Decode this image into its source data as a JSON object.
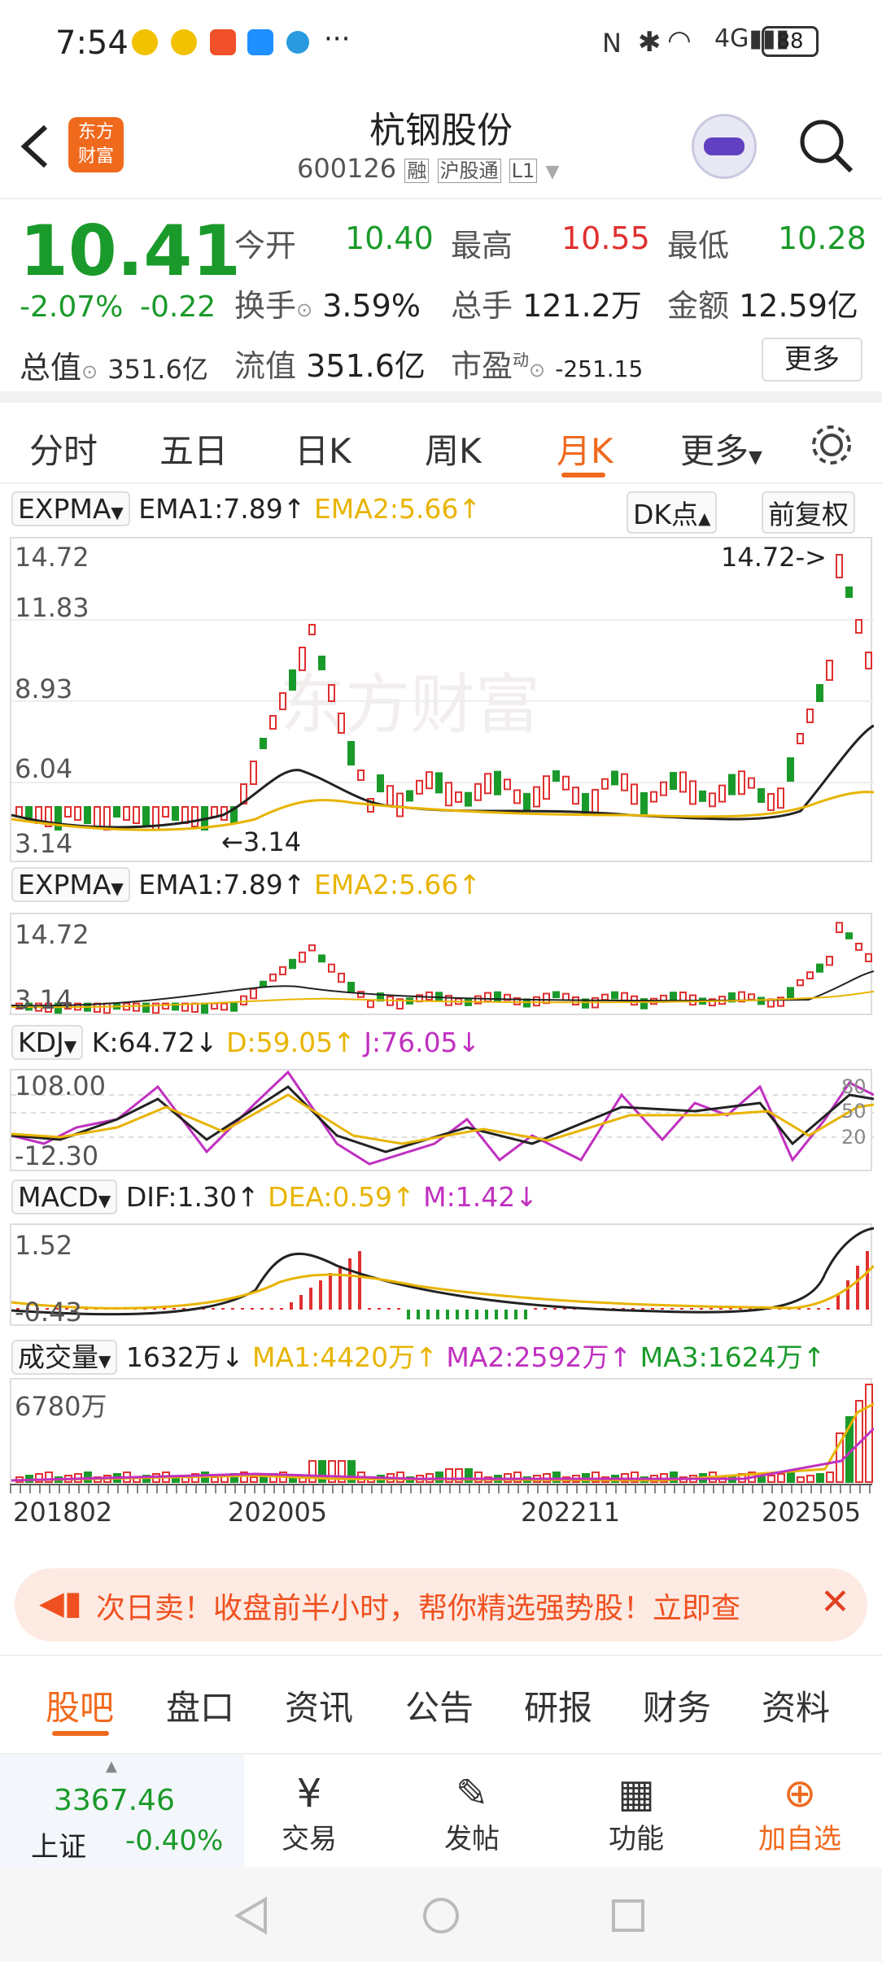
{
  "status": {
    "time": "7:54",
    "dots": "···",
    "battery": "88"
  },
  "header": {
    "title": "杭钢股份",
    "code": "600126",
    "tag1": "融",
    "tag2": "沪股通",
    "tag3": "L1",
    "logo_line1": "东方",
    "logo_line2": "财富"
  },
  "quote": {
    "price": "10.41",
    "change_pct": "-2.07%",
    "change": "-0.22",
    "open_label": "今开",
    "open": "10.40",
    "high_label": "最高",
    "high": "10.55",
    "low_label": "最低",
    "low": "10.28",
    "turnover_label": "换手",
    "turnover": "3.59%",
    "volume_label": "总手",
    "volume": "121.2万",
    "amount_label": "金额",
    "amount": "12.59亿",
    "mcap_label": "总值",
    "mcap": "351.6亿",
    "float_label": "流值",
    "float": "351.6亿",
    "pe_label": "市盈",
    "pe_sup": "动",
    "pe": "-251.15",
    "more": "更多"
  },
  "tabs": [
    "分时",
    "五日",
    "日K",
    "周K",
    "月K",
    "更多"
  ],
  "active_tab": "月K",
  "main": {
    "ind": "EXPMA",
    "ema1": "EMA1:7.89↑",
    "ema2": "EMA2:5.66↑",
    "dk": "DK点",
    "fq": "前复权",
    "y_labels": [
      "14.72",
      "11.83",
      "8.93",
      "6.04",
      "3.14"
    ],
    "max_label": "14.72->",
    "min_label": "←3.14",
    "watermark": "东方财富"
  },
  "expma": {
    "ind": "EXPMA",
    "ema1": "EMA1:7.89↑",
    "ema2": "EMA2:5.66↑",
    "y_top": "14.72",
    "y_bot": "3.14"
  },
  "kdj": {
    "ind": "KDJ",
    "k": "K:64.72↓",
    "d": "D:59.05↑",
    "j": "J:76.05↓",
    "y_top": "108.00",
    "y_bot": "-12.30",
    "r80": "80",
    "r50": "50",
    "r20": "20"
  },
  "macd": {
    "ind": "MACD",
    "dif": "DIF:1.30↑",
    "dea": "DEA:0.59↑",
    "m": "M:1.42↓",
    "y_top": "1.52",
    "y_bot": "-0.43"
  },
  "vol": {
    "ind": "成交量",
    "v": "1632万↓",
    "ma1": "MA1:4420万↑",
    "ma2": "MA2:2592万↑",
    "ma3": "MA3:1624万↑",
    "y_top": "6780万"
  },
  "x_labels": [
    "201802",
    "202005",
    "202211",
    "202505"
  ],
  "banner": {
    "text": "次日卖！收盘前半小时，帮你精选强势股！立即查"
  },
  "subtabs": [
    "股吧",
    "盘口",
    "资讯",
    "公告",
    "研报",
    "财务",
    "资料"
  ],
  "active_subtab": "股吧",
  "bottom": {
    "index_value": "3367.46",
    "index_name": "上证",
    "index_change": "-0.40%",
    "trade": "交易",
    "post": "发帖",
    "func": "功能",
    "add": "加自选"
  },
  "chart_data": {
    "type": "candlestick",
    "period": "monthly",
    "x_range": [
      "201802",
      "202505"
    ],
    "y_range": [
      3.14,
      14.72
    ],
    "last_price": 10.41,
    "max": 14.72,
    "min": 3.14
  },
  "colors": {
    "up": "#e03030",
    "down": "#1a9a2a",
    "accent": "#f06a1e",
    "ema2": "#e8b400",
    "j": "#c030c0"
  }
}
